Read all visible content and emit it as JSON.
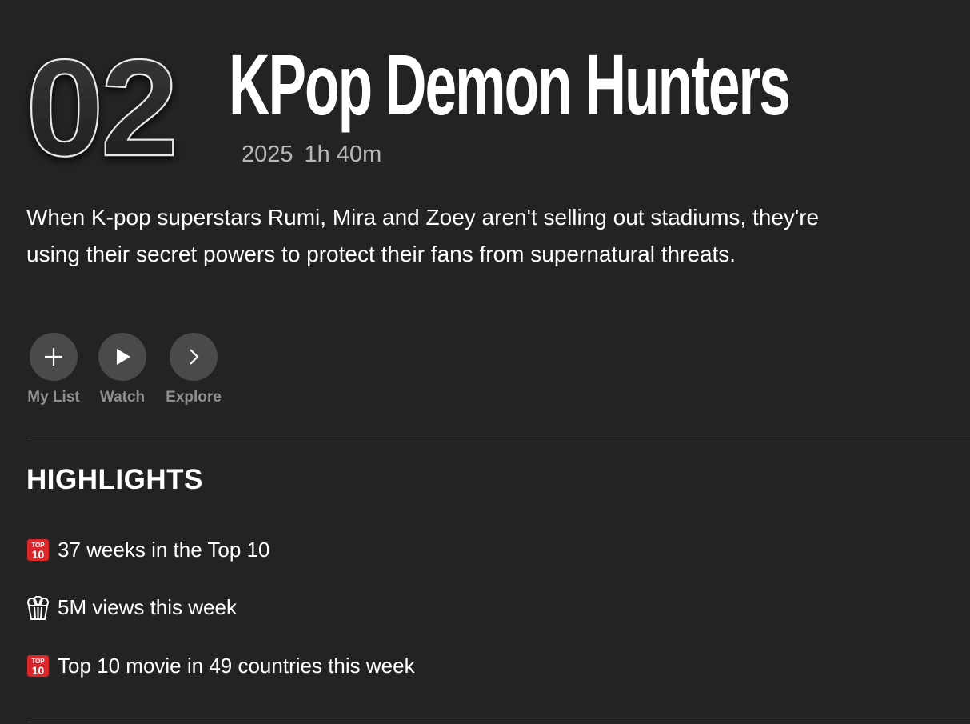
{
  "title": {
    "rank": "02",
    "name": "KPop Demon Hunters",
    "year": "2025",
    "duration": "1h 40m"
  },
  "synopsis": "When K-pop superstars Rumi, Mira and Zoey aren't selling out stadiums, they're using their secret powers to protect their fans from supernatural threats.",
  "actions": [
    {
      "label": "My List",
      "icon": "plus-icon"
    },
    {
      "label": "Watch",
      "icon": "play-icon"
    },
    {
      "label": "Explore",
      "icon": "chevron-right-icon"
    }
  ],
  "highlights": {
    "heading": "HIGHLIGHTS",
    "items": [
      {
        "icon": "top-10-icon",
        "text": "37 weeks in the Top 10"
      },
      {
        "icon": "popcorn-icon",
        "text": "5M views this week"
      },
      {
        "icon": "top-10-icon",
        "text": "Top 10 movie in 49 countries this week"
      }
    ]
  },
  "colors": {
    "background": "#232323",
    "button": "#4a4a4a",
    "muted_text": "#8f8f8f",
    "top10_badge": "#d9252c"
  }
}
